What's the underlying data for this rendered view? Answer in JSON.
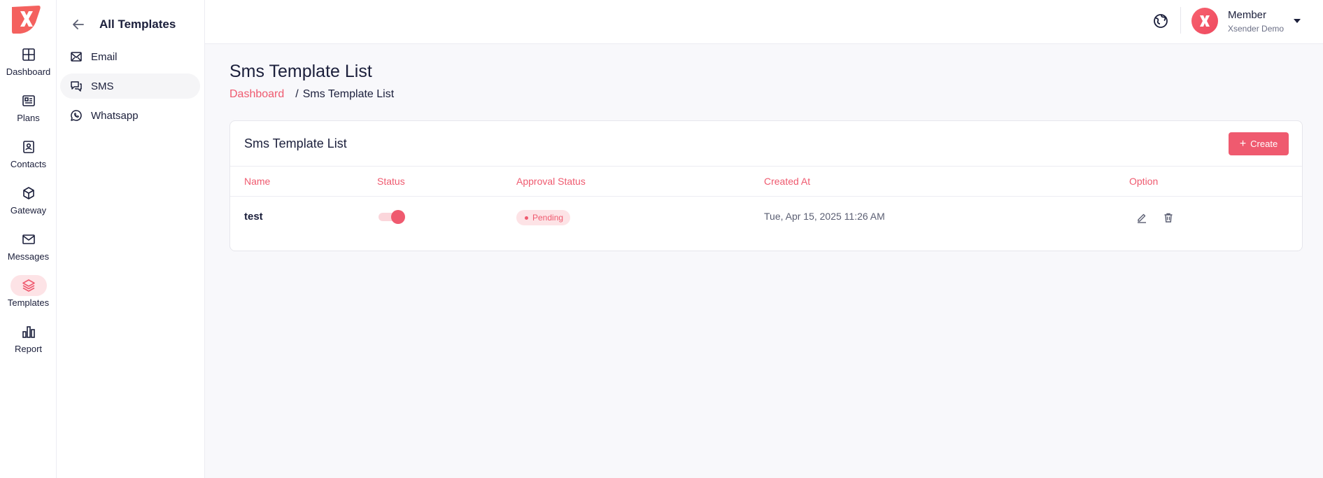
{
  "rail": {
    "items": [
      {
        "label": "Dashboard"
      },
      {
        "label": "Plans"
      },
      {
        "label": "Contacts"
      },
      {
        "label": "Gateway"
      },
      {
        "label": "Messages"
      },
      {
        "label": "Templates"
      },
      {
        "label": "Report"
      }
    ],
    "active": "Templates"
  },
  "submenu": {
    "title": "All Templates",
    "items": [
      {
        "label": "Email"
      },
      {
        "label": "SMS"
      },
      {
        "label": "Whatsapp"
      }
    ],
    "active": "SMS"
  },
  "topbar": {
    "user_name": "Member",
    "user_org": "Xsender Demo"
  },
  "page": {
    "title": "Sms Template List",
    "breadcrumb": {
      "home": "Dashboard",
      "separator": "/",
      "current": "Sms Template List"
    }
  },
  "card": {
    "title": "Sms Template List",
    "create_label": "Create",
    "columns": [
      "Name",
      "Status",
      "Approval Status",
      "Created At",
      "Option"
    ],
    "rows": [
      {
        "name": "test",
        "status_enabled": true,
        "approval": "Pending",
        "created_at": "Tue, Apr 15, 2025 11:26 AM"
      }
    ]
  },
  "colors": {
    "accent": "#ef5a6f",
    "accent_light": "#fde3e6",
    "text": "#1b1f3b",
    "background": "#f8f8fb"
  }
}
